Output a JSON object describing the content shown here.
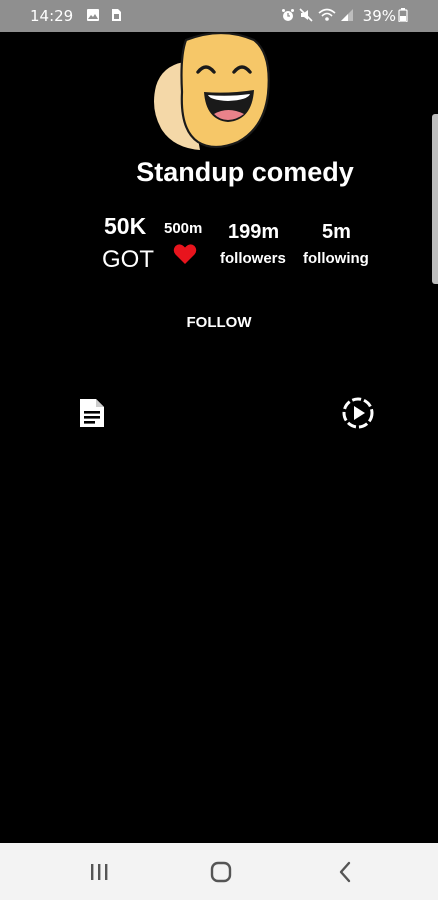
{
  "status_bar": {
    "time": "14:29",
    "battery": "39%",
    "icons": [
      "image-icon",
      "sim-icon",
      "alarm-icon",
      "mute-icon",
      "wifi-icon",
      "signal-icon",
      "battery-icon"
    ]
  },
  "profile": {
    "name": "Standup comedy",
    "avatar_icon": "laughing-mask-icon",
    "stats": {
      "got_value": "50K",
      "got_label": "GOT",
      "likes_value": "500m",
      "likes_icon": "heart-icon",
      "followers_value": "199m",
      "followers_label": "followers",
      "following_value": "5m",
      "following_label": "following"
    },
    "follow_label": "FOLLOW"
  },
  "tabs": [
    {
      "icon": "document-icon"
    },
    {
      "icon": "play-circle-icon"
    }
  ],
  "colors": {
    "background": "#000000",
    "status_bar": "#8f8f8f",
    "heart": "#e8141d",
    "avatar": "#f6c768",
    "nav_bar": "#f3f3f3"
  },
  "nav_bar": {
    "icons": [
      "recents-icon",
      "home-icon",
      "back-icon"
    ]
  }
}
